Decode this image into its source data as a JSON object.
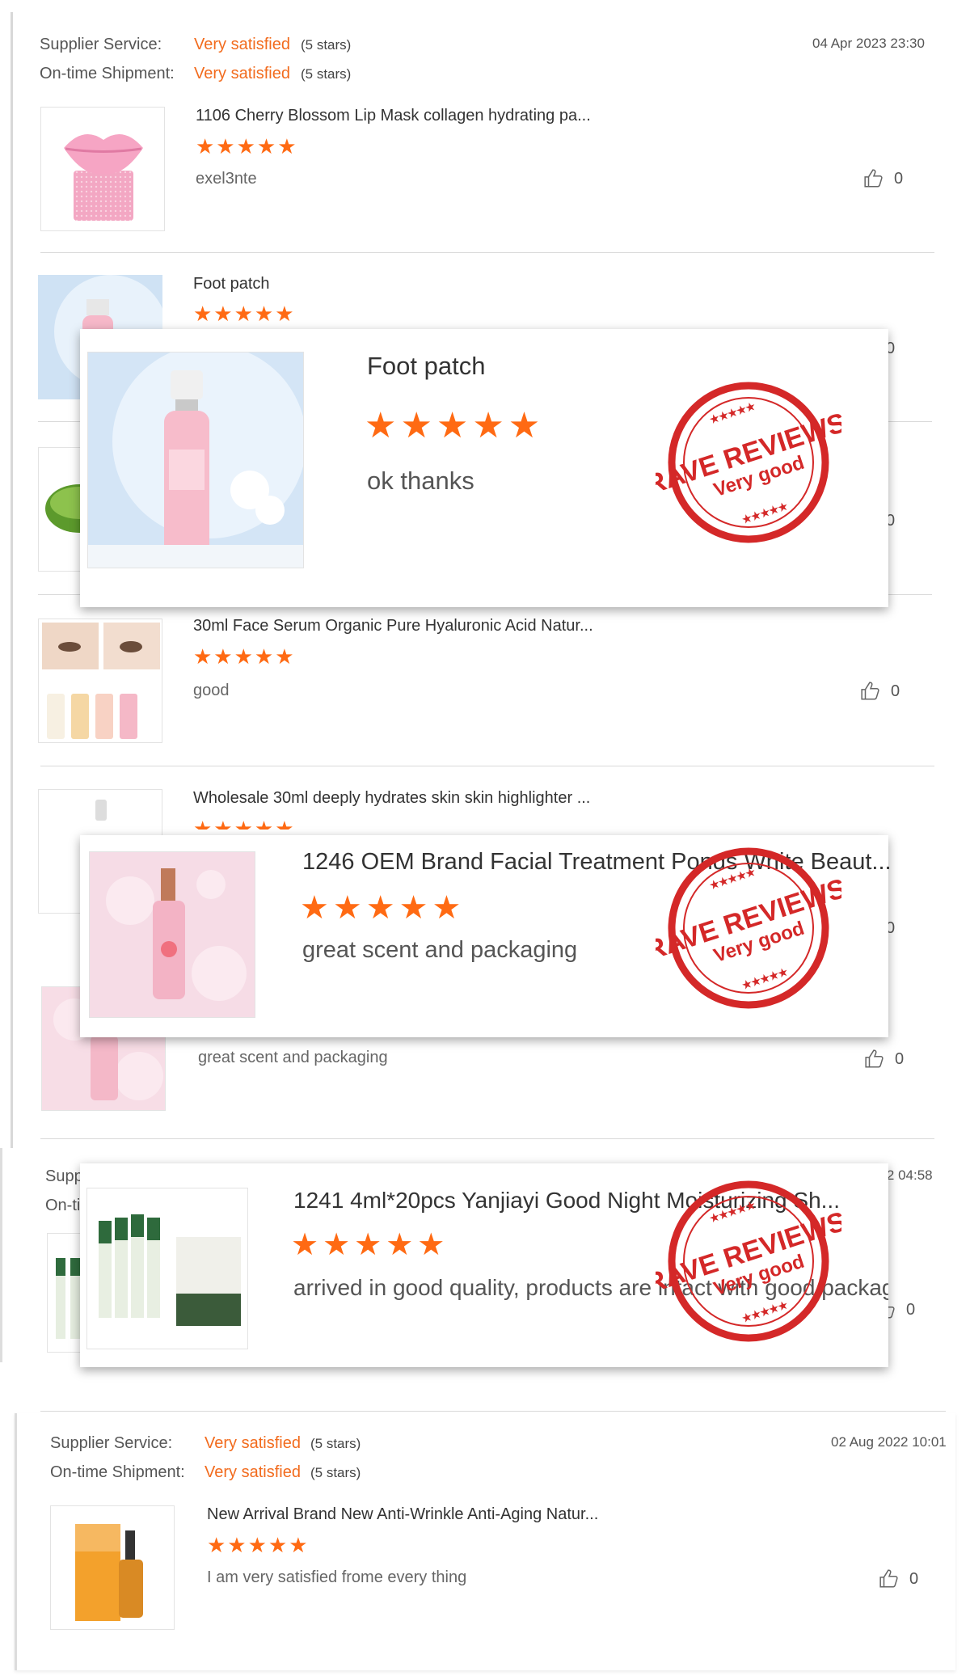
{
  "labels": {
    "supplier_service": "Supplier Service:",
    "ontime_shipment": "On-time Shipment:",
    "very_satisfied": "Very satisfied",
    "five_stars": "(5 stars)"
  },
  "reviews": [
    {
      "date": "04 Apr 2023 23:30",
      "title": "1106 Cherry Blossom Lip Mask collagen hydrating pa...",
      "rating": "★★★★★",
      "comment": "exel3nte",
      "likes": "0",
      "image": "lip-mask-image"
    },
    {
      "title": "Foot patch",
      "rating": "★★★★★",
      "likes": "0",
      "image": "pink-spray-bottle-image"
    },
    {
      "likes": "0",
      "image": "green-gel-jar-image"
    },
    {
      "title": "30ml Face Serum Organic Pure Hyaluronic Acid Natur...",
      "rating": "★★★★★",
      "comment": "good",
      "likes": "0",
      "image": "face-serum-bottles-image"
    },
    {
      "title": "Wholesale 30ml deeply hydrates skin skin highlighter ...",
      "rating": "★★★★★",
      "likes": "0",
      "image": "dropper-bottle-image"
    },
    {
      "comment": "great scent and packaging",
      "likes": "0",
      "image": "pink-serum-image"
    },
    {
      "date_partial": "022 04:58",
      "likes": "0",
      "image": "sleeping-mask-tubes-image"
    },
    {
      "date": "02 Aug 2022 10:01",
      "title": "New Arrival Brand New Anti-Wrinkle Anti-Aging Natur...",
      "rating": "★★★★★",
      "comment": "I am very satisfied frome every thing",
      "likes": "0",
      "image": "vitamin-c-serum-image"
    }
  ],
  "partial_labels": {
    "supplier": "Supp",
    "ontime": "On-ti"
  },
  "highlights": [
    {
      "title": "Foot patch",
      "rating": "★★★★★",
      "comment": "ok thanks"
    },
    {
      "title": "1246 OEM Brand Facial Treatment Ponds White Beaut...",
      "rating": "★★★★★",
      "comment": "great scent and packaging"
    },
    {
      "title": "1241 4ml*20pcs Yanjiayi Good Night Moisturizing Sh...",
      "rating": "★★★★★",
      "comment": "arrived in good quality, products are intact with good packagir"
    }
  ],
  "stamp": {
    "line1": "RAVE REVIEWS",
    "line2": "Very good",
    "stars_top": "★★★★★",
    "stars_bottom": "★★★★★"
  },
  "colors": {
    "accent": "#f26b1d",
    "star": "#ff6a13",
    "stamp": "#d42828"
  }
}
